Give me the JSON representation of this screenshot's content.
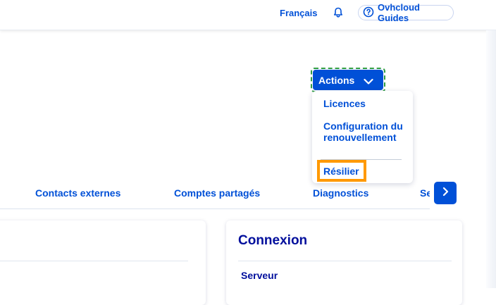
{
  "topbar": {
    "language": "Français",
    "guides_label": "Ovhcloud Guides",
    "icons": [
      "bell-icon",
      "help-circle-icon"
    ]
  },
  "actions": {
    "button_label": "Actions",
    "menu": {
      "licences": "Licences",
      "renewal_config": "Configuration du renouvellement",
      "terminate": "Résilier"
    }
  },
  "tabs": [
    "Contacts externes",
    "Comptes partagés",
    "Diagnostics",
    "Se"
  ],
  "cards": {
    "connexion": {
      "title": "Connexion",
      "subtitle": "Serveur"
    }
  },
  "colors": {
    "primary": "#0050d7",
    "heading": "#000e9c",
    "highlight": "#ff9900",
    "focus_outline": "#2e9c43"
  }
}
